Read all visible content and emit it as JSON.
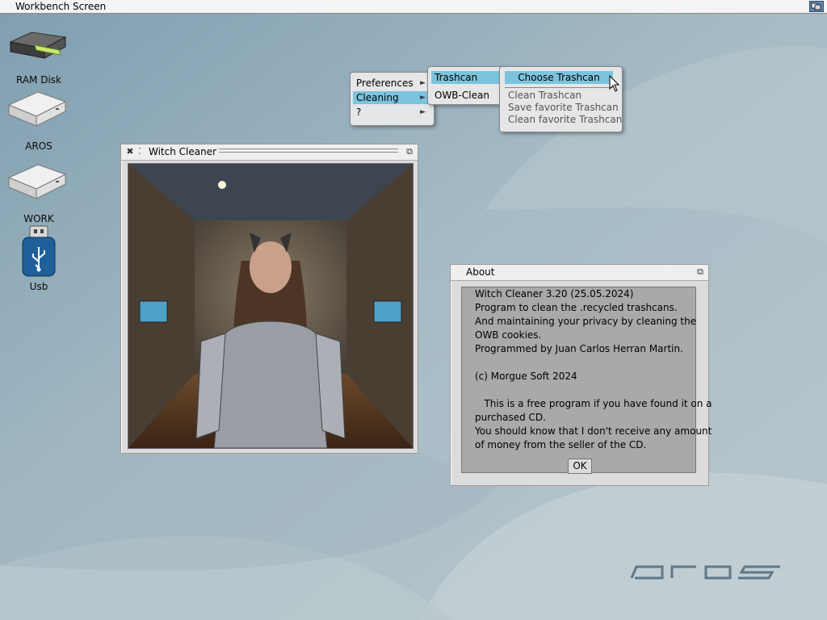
{
  "screen": {
    "title": "Workbench Screen"
  },
  "desktop_icons": [
    {
      "label": "RAM Disk",
      "icon": "ram-disk-icon"
    },
    {
      "label": "AROS",
      "icon": "drive-icon"
    },
    {
      "label": "WORK",
      "icon": "drive-icon"
    },
    {
      "label": "Usb",
      "icon": "usb-icon"
    }
  ],
  "menu": {
    "main": [
      {
        "label": "Preferences",
        "has_submenu": true
      },
      {
        "label": "Cleaning",
        "has_submenu": true,
        "selected": true
      },
      {
        "label": "?",
        "has_submenu": true
      }
    ],
    "cleaning": [
      {
        "label": "Trashcan",
        "selected": true
      },
      {
        "label": "OWB-Clean"
      }
    ],
    "trashcan": [
      {
        "label": "Choose Trashcan",
        "selected": true
      },
      {
        "label": "Clean Trashcan"
      },
      {
        "label": "Save favorite Trashcan"
      },
      {
        "label": "Clean favorite Trashcan"
      }
    ]
  },
  "witch_window": {
    "title": "Witch Cleaner"
  },
  "about_window": {
    "title": "About",
    "lines": [
      "Witch Cleaner 3.20 (25.05.2024)",
      "Program to clean the .recycled trashcans.",
      "And maintaining your privacy by cleaning the",
      "OWB cookies.",
      "Programmed by Juan Carlos Herran Martin.",
      "",
      "(c) Morgue Soft 2024",
      "",
      "   This is a free program if you have found it on a",
      "purchased CD.",
      "You should know that I don't receive any amount",
      "of money from the seller of the CD."
    ],
    "ok_label": "OK"
  },
  "colors": {
    "menu_highlight": "#7cc3dd",
    "desktop": "#a9bcc4",
    "window_bg": "#dcdcdc"
  }
}
